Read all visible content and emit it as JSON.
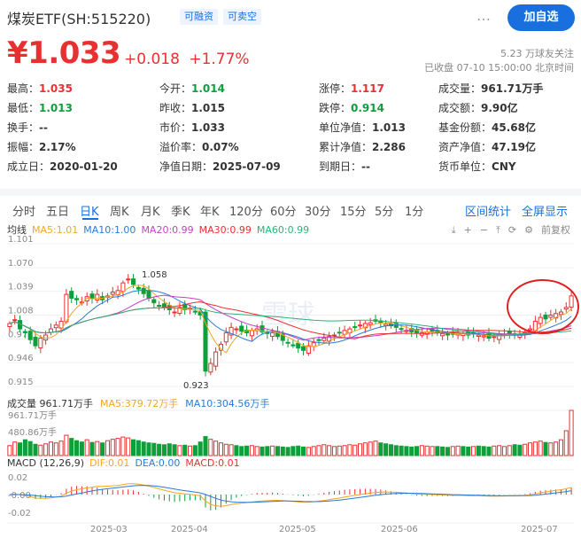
{
  "header": {
    "title": "煤炭ETF(SH:515220)",
    "tags": [
      "可融资",
      "可卖空"
    ],
    "more": "…",
    "add_label": "加自选"
  },
  "quote": {
    "price": "¥1.033",
    "change": "+0.018",
    "change_pct": "+1.77%",
    "followers": "5.23 万球友关注",
    "status": "已收盘 07-10 15:00:00 北京时间"
  },
  "stats": [
    [
      [
        "最高：",
        "1.035",
        "red"
      ],
      [
        "今开：",
        "1.014",
        "green"
      ],
      [
        "涨停：",
        "1.117",
        "red"
      ],
      [
        "成交量：",
        "961.71万手",
        ""
      ]
    ],
    [
      [
        "最低：",
        "1.013",
        "green"
      ],
      [
        "昨收：",
        "1.015",
        ""
      ],
      [
        "跌停：",
        "0.914",
        "green"
      ],
      [
        "成交额：",
        "9.90亿",
        ""
      ]
    ],
    [
      [
        "换手：",
        "--",
        ""
      ],
      [
        "市价：",
        "1.033",
        ""
      ],
      [
        "单位净值：",
        "1.013",
        ""
      ],
      [
        "基金份额：",
        "45.68亿",
        ""
      ]
    ],
    [
      [
        "振幅：",
        "2.17%",
        ""
      ],
      [
        "溢价率：",
        "0.07%",
        ""
      ],
      [
        "累计净值：",
        "2.286",
        ""
      ],
      [
        "资产净值：",
        "47.19亿",
        ""
      ]
    ],
    [
      [
        "成立日：",
        "2020-01-20",
        ""
      ],
      [
        "净值日期：",
        "2025-07-09",
        ""
      ],
      [
        "到期日：",
        "--",
        ""
      ],
      [
        "货币单位：",
        "CNY",
        ""
      ]
    ]
  ],
  "tabs": [
    "分时",
    "五日",
    "日K",
    "周K",
    "月K",
    "季K",
    "年K",
    "120分",
    "60分",
    "30分",
    "15分",
    "5分",
    "1分"
  ],
  "active_tab": "日K",
  "tab_links": [
    "区间统计",
    "全屏显示"
  ],
  "ma_legend": [
    {
      "text": "均线",
      "color": "#333333"
    },
    {
      "text": "MA5:1.01",
      "color": "#f5a623"
    },
    {
      "text": "MA10:1.00",
      "color": "#2a7ad6"
    },
    {
      "text": "MA20:0.99",
      "color": "#c441c4"
    },
    {
      "text": "MA30:0.99",
      "color": "#e93030"
    },
    {
      "text": "MA60:0.99",
      "color": "#2bb37a"
    }
  ],
  "chart_tools": [
    "⤓",
    "+",
    "−",
    "⤒",
    "⟳",
    "⚙",
    "前复权"
  ],
  "vol_legend": [
    {
      "text": "成交量 961.71万手",
      "color": "#333333"
    },
    {
      "text": "MA5:379.72万手",
      "color": "#f5a623"
    },
    {
      "text": "MA10:304.56万手",
      "color": "#2a7ad6"
    }
  ],
  "macd_legend": [
    {
      "text": "MACD (12,26,9)",
      "color": "#333333"
    },
    {
      "text": "DIF:0.01",
      "color": "#f5a623"
    },
    {
      "text": "DEA:0.00",
      "color": "#2a7ad6"
    },
    {
      "text": "MACD:0.01",
      "color": "#e93030"
    }
  ],
  "colors": {
    "up": "#e93030",
    "down": "#0e9f3b",
    "accent": "#1a6fdf"
  },
  "chart_data": {
    "type": "candlestick",
    "price_axis": {
      "ticks": [
        "1.101",
        "1.070",
        "1.039",
        "1.008",
        "0.977",
        "0.946",
        "0.915"
      ],
      "range": [
        0.915,
        1.101
      ]
    },
    "x_labels": [
      "2025-03",
      "2025-04",
      "2025-05",
      "2025-06",
      "2025-07"
    ],
    "high_marker": "1.058",
    "low_marker": "0.923",
    "vol_axis": [
      "961.71万手",
      "480.86万手"
    ],
    "macd_axis": [
      "0.02",
      "-0.00",
      "-0.02"
    ],
    "closes": [
      0.997,
      1.002,
      0.99,
      0.985,
      0.976,
      0.968,
      0.978,
      0.982,
      0.99,
      0.995,
      1.0,
      1.035,
      1.03,
      1.028,
      1.025,
      1.032,
      1.03,
      1.035,
      1.028,
      1.033,
      1.038,
      1.04,
      1.05,
      1.055,
      1.048,
      1.042,
      1.036,
      1.03,
      1.024,
      1.02,
      1.018,
      1.015,
      1.012,
      1.018,
      1.015,
      1.017,
      1.012,
      1.008,
      0.935,
      0.945,
      0.96,
      0.97,
      0.985,
      0.992,
      0.99,
      0.987,
      0.985,
      0.988,
      0.99,
      0.986,
      0.984,
      0.985,
      0.98,
      0.975,
      0.972,
      0.968,
      0.965,
      0.962,
      0.968,
      0.972,
      0.975,
      0.978,
      0.98,
      0.982,
      0.985,
      0.988,
      0.99,
      0.992,
      0.995,
      0.997,
      0.998,
      1.0,
      0.998,
      0.996,
      0.994,
      0.992,
      0.99,
      0.988,
      0.986,
      0.985,
      0.985,
      0.986,
      0.987,
      0.985,
      0.984,
      0.982,
      0.983,
      0.985,
      0.984,
      0.982,
      0.983,
      0.982,
      0.981,
      0.978,
      0.98,
      0.982,
      0.983,
      0.984,
      0.983,
      0.982,
      0.985,
      0.99,
      1.0,
      1.005,
      1.003,
      1.008,
      1.01,
      1.012,
      1.018,
      1.033
    ],
    "volume_fraction": [
      0.22,
      0.3,
      0.28,
      0.35,
      0.31,
      0.25,
      0.23,
      0.26,
      0.3,
      0.28,
      0.32,
      0.45,
      0.38,
      0.33,
      0.3,
      0.35,
      0.29,
      0.31,
      0.28,
      0.33,
      0.36,
      0.38,
      0.41,
      0.39,
      0.35,
      0.33,
      0.3,
      0.28,
      0.27,
      0.25,
      0.24,
      0.26,
      0.24,
      0.22,
      0.23,
      0.21,
      0.22,
      0.3,
      0.42,
      0.36,
      0.32,
      0.28,
      0.25,
      0.24,
      0.22,
      0.2,
      0.21,
      0.22,
      0.2,
      0.19,
      0.2,
      0.21,
      0.2,
      0.19,
      0.18,
      0.2,
      0.21,
      0.19,
      0.18,
      0.2,
      0.22,
      0.24,
      0.22,
      0.2,
      0.21,
      0.22,
      0.24,
      0.23,
      0.26,
      0.28,
      0.3,
      0.32,
      0.28,
      0.26,
      0.24,
      0.22,
      0.21,
      0.2,
      0.19,
      0.2,
      0.22,
      0.21,
      0.2,
      0.2,
      0.19,
      0.18,
      0.2,
      0.21,
      0.2,
      0.19,
      0.2,
      0.21,
      0.2,
      0.19,
      0.21,
      0.22,
      0.2,
      0.22,
      0.24,
      0.23,
      0.25,
      0.28,
      0.3,
      0.32,
      0.29,
      0.28,
      0.3,
      0.35,
      0.55,
      1.0
    ]
  }
}
